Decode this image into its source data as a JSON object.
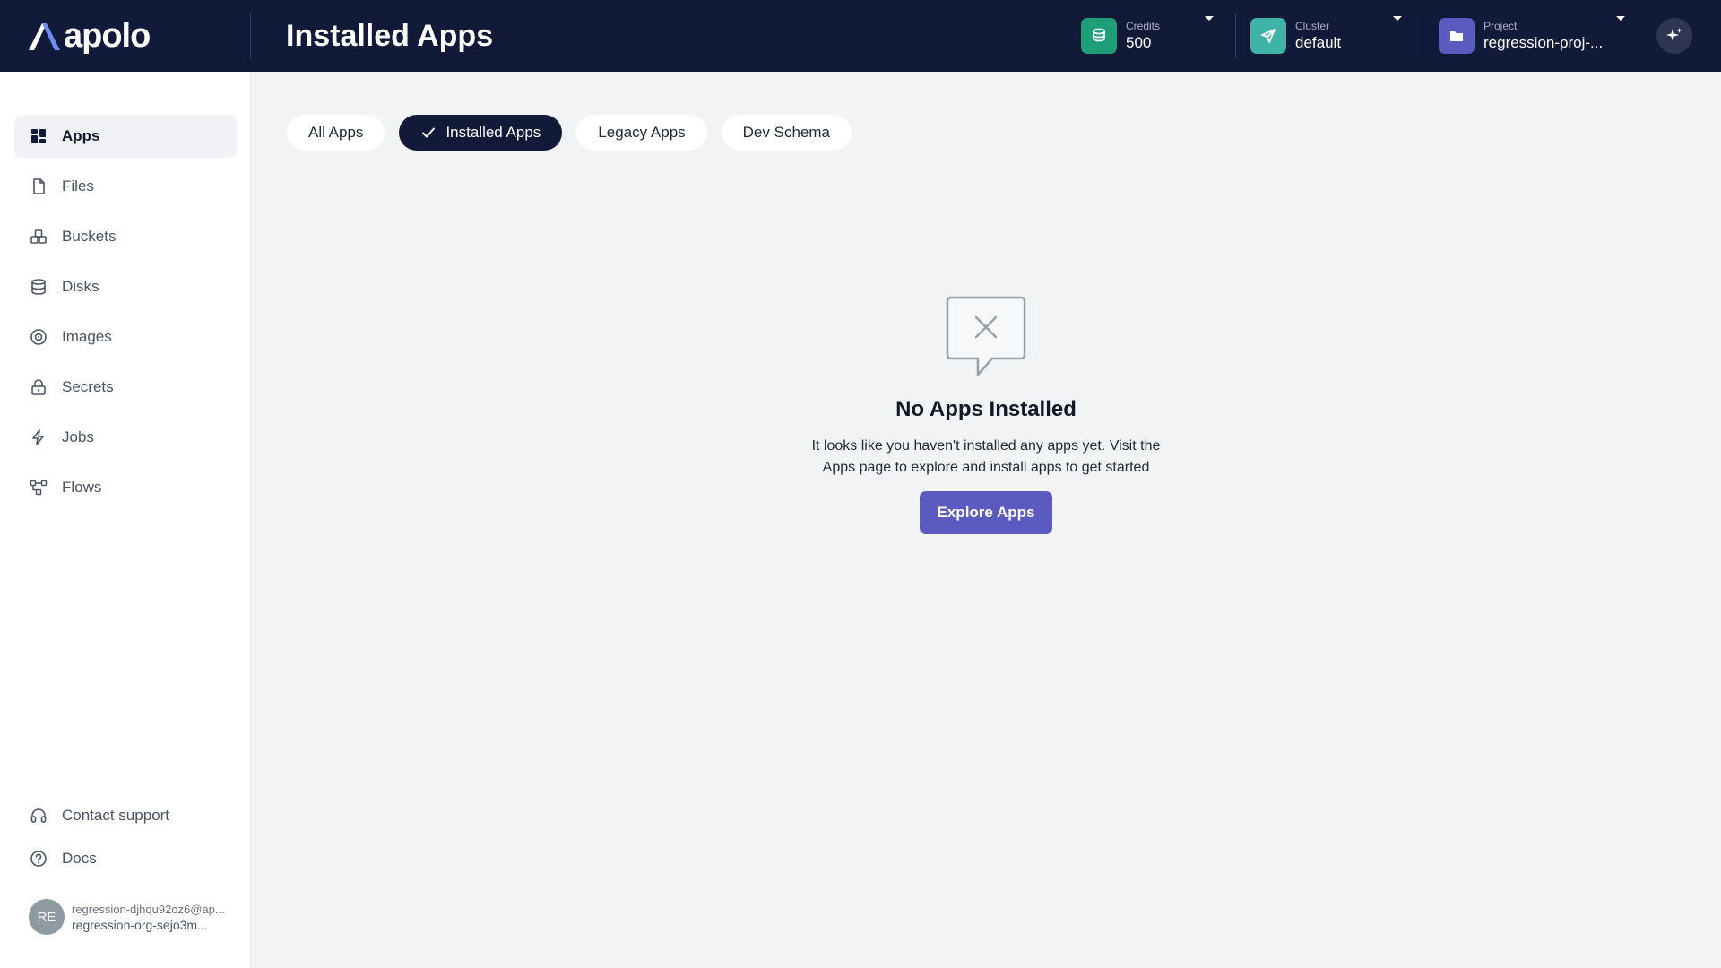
{
  "header": {
    "logo_text": "apolo",
    "title": "Installed Apps",
    "credits": {
      "label": "Credits",
      "value": "500",
      "icon": "coins-icon",
      "color": "#1f9e7a"
    },
    "cluster": {
      "label": "Cluster",
      "value": "default",
      "icon": "send-icon",
      "color": "#3fb3a6"
    },
    "project": {
      "label": "Project",
      "value": "regression-proj-...",
      "icon": "folder-icon",
      "color": "#5b5bbf"
    },
    "assistant_icon": "sparkles-icon"
  },
  "sidebar": {
    "items": [
      {
        "label": "Apps",
        "icon": "apps-grid-icon",
        "active": true
      },
      {
        "label": "Files",
        "icon": "file-icon"
      },
      {
        "label": "Buckets",
        "icon": "buckets-icon"
      },
      {
        "label": "Disks",
        "icon": "database-icon"
      },
      {
        "label": "Images",
        "icon": "disc-icon"
      },
      {
        "label": "Secrets",
        "icon": "lock-icon"
      },
      {
        "label": "Jobs",
        "icon": "lightning-icon"
      },
      {
        "label": "Flows",
        "icon": "flow-icon"
      }
    ],
    "footer": [
      {
        "label": "Contact support",
        "icon": "headset-icon"
      },
      {
        "label": "Docs",
        "icon": "question-icon"
      }
    ],
    "user": {
      "initials": "RE",
      "email": "regression-djhqu92oz6@ap...",
      "org": "regression-org-sejo3m..."
    }
  },
  "tabs": [
    {
      "label": "All Apps",
      "active": false
    },
    {
      "label": "Installed Apps",
      "active": true
    },
    {
      "label": "Legacy Apps",
      "active": false
    },
    {
      "label": "Dev Schema",
      "active": false
    }
  ],
  "empty_state": {
    "icon": "message-x-icon",
    "title": "No Apps Installed",
    "description": "It looks like you haven't installed any apps yet. Visit the Apps page to explore and install apps to get started",
    "button_label": "Explore Apps"
  },
  "colors": {
    "topbar": "#121a3a",
    "accent": "#5b5bbf",
    "background": "#f2f3f5"
  }
}
